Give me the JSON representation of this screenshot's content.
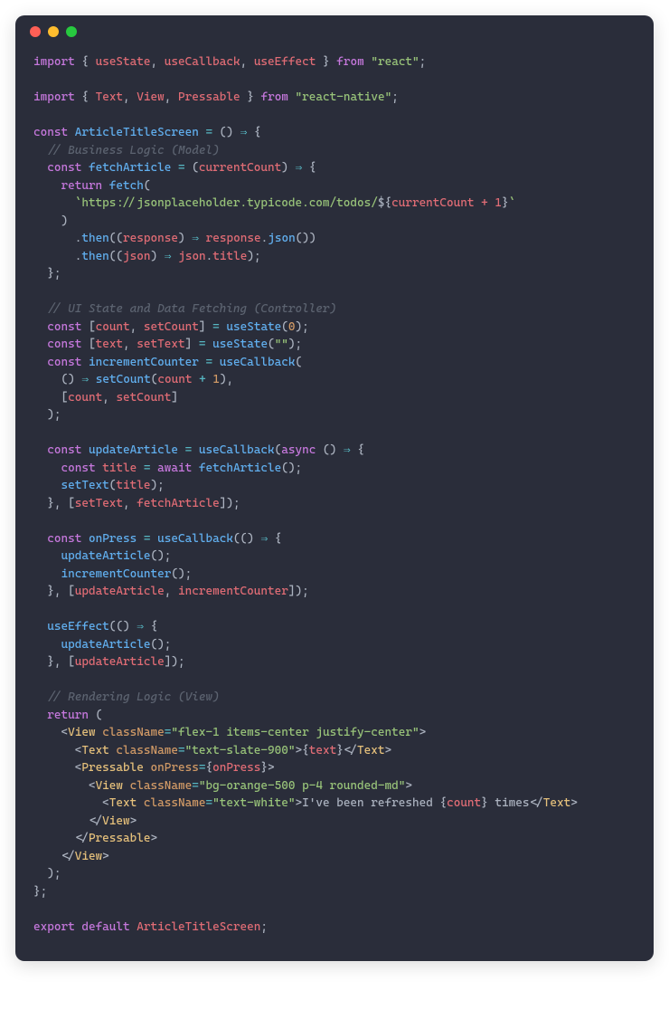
{
  "window": {
    "background": "#2a2d3a",
    "dots": [
      "#ff5f56",
      "#ffbd2e",
      "#27c93f"
    ]
  },
  "code": {
    "lines": [
      [
        [
          "kw",
          "import"
        ],
        [
          "w",
          " "
        ],
        [
          "p",
          "{"
        ],
        [
          "w",
          " "
        ],
        [
          "var",
          "useState"
        ],
        [
          "p",
          ","
        ],
        [
          "w",
          " "
        ],
        [
          "var",
          "useCallback"
        ],
        [
          "p",
          ","
        ],
        [
          "w",
          " "
        ],
        [
          "var",
          "useEffect"
        ],
        [
          "w",
          " "
        ],
        [
          "p",
          "}"
        ],
        [
          "w",
          " "
        ],
        [
          "kw",
          "from"
        ],
        [
          "w",
          " "
        ],
        [
          "str",
          "\"react\""
        ],
        [
          "p",
          ";"
        ]
      ],
      [],
      [
        [
          "kw",
          "import"
        ],
        [
          "w",
          " "
        ],
        [
          "p",
          "{"
        ],
        [
          "w",
          " "
        ],
        [
          "var",
          "Text"
        ],
        [
          "p",
          ","
        ],
        [
          "w",
          " "
        ],
        [
          "var",
          "View"
        ],
        [
          "p",
          ","
        ],
        [
          "w",
          " "
        ],
        [
          "var",
          "Pressable"
        ],
        [
          "w",
          " "
        ],
        [
          "p",
          "}"
        ],
        [
          "w",
          " "
        ],
        [
          "kw",
          "from"
        ],
        [
          "w",
          " "
        ],
        [
          "str",
          "\"react-native\""
        ],
        [
          "p",
          ";"
        ]
      ],
      [],
      [
        [
          "kw",
          "const"
        ],
        [
          "w",
          " "
        ],
        [
          "fn",
          "ArticleTitleScreen"
        ],
        [
          "w",
          " "
        ],
        [
          "op",
          "="
        ],
        [
          "w",
          " "
        ],
        [
          "p",
          "()"
        ],
        [
          "w",
          " "
        ],
        [
          "op",
          "⇒"
        ],
        [
          "w",
          " "
        ],
        [
          "p",
          "{"
        ]
      ],
      [
        [
          "w",
          "  "
        ],
        [
          "cm",
          "// Business Logic (Model)"
        ]
      ],
      [
        [
          "w",
          "  "
        ],
        [
          "kw",
          "const"
        ],
        [
          "w",
          " "
        ],
        [
          "fn",
          "fetchArticle"
        ],
        [
          "w",
          " "
        ],
        [
          "op",
          "="
        ],
        [
          "w",
          " "
        ],
        [
          "p",
          "("
        ],
        [
          "var",
          "currentCount"
        ],
        [
          "p",
          ")"
        ],
        [
          "w",
          " "
        ],
        [
          "op",
          "⇒"
        ],
        [
          "w",
          " "
        ],
        [
          "p",
          "{"
        ]
      ],
      [
        [
          "w",
          "    "
        ],
        [
          "kw",
          "return"
        ],
        [
          "w",
          " "
        ],
        [
          "fn",
          "fetch"
        ],
        [
          "p",
          "("
        ]
      ],
      [
        [
          "w",
          "      "
        ],
        [
          "str",
          "`https://jsonplaceholder.typicode.com/todos/"
        ],
        [
          "p",
          "${"
        ],
        [
          "tmpl",
          "currentCount + 1"
        ],
        [
          "p",
          "}"
        ],
        [
          "str",
          "`"
        ]
      ],
      [
        [
          "w",
          "    "
        ],
        [
          "p",
          ")"
        ]
      ],
      [
        [
          "w",
          "      "
        ],
        [
          "p",
          "."
        ],
        [
          "fn",
          "then"
        ],
        [
          "p",
          "(("
        ],
        [
          "var",
          "response"
        ],
        [
          "p",
          ")"
        ],
        [
          "w",
          " "
        ],
        [
          "op",
          "⇒"
        ],
        [
          "w",
          " "
        ],
        [
          "var",
          "response"
        ],
        [
          "p",
          "."
        ],
        [
          "fn",
          "json"
        ],
        [
          "p",
          "())"
        ]
      ],
      [
        [
          "w",
          "      "
        ],
        [
          "p",
          "."
        ],
        [
          "fn",
          "then"
        ],
        [
          "p",
          "(("
        ],
        [
          "var",
          "json"
        ],
        [
          "p",
          ")"
        ],
        [
          "w",
          " "
        ],
        [
          "op",
          "⇒"
        ],
        [
          "w",
          " "
        ],
        [
          "var",
          "json"
        ],
        [
          "p",
          "."
        ],
        [
          "prop",
          "title"
        ],
        [
          "p",
          ");"
        ]
      ],
      [
        [
          "w",
          "  "
        ],
        [
          "p",
          "};"
        ]
      ],
      [],
      [
        [
          "w",
          "  "
        ],
        [
          "cm",
          "// UI State and Data Fetching (Controller)"
        ]
      ],
      [
        [
          "w",
          "  "
        ],
        [
          "kw",
          "const"
        ],
        [
          "w",
          " "
        ],
        [
          "p",
          "["
        ],
        [
          "var",
          "count"
        ],
        [
          "p",
          ","
        ],
        [
          "w",
          " "
        ],
        [
          "var",
          "setCount"
        ],
        [
          "p",
          "]"
        ],
        [
          "w",
          " "
        ],
        [
          "op",
          "="
        ],
        [
          "w",
          " "
        ],
        [
          "fn",
          "useState"
        ],
        [
          "p",
          "("
        ],
        [
          "num",
          "0"
        ],
        [
          "p",
          ");"
        ]
      ],
      [
        [
          "w",
          "  "
        ],
        [
          "kw",
          "const"
        ],
        [
          "w",
          " "
        ],
        [
          "p",
          "["
        ],
        [
          "var",
          "text"
        ],
        [
          "p",
          ","
        ],
        [
          "w",
          " "
        ],
        [
          "var",
          "setText"
        ],
        [
          "p",
          "]"
        ],
        [
          "w",
          " "
        ],
        [
          "op",
          "="
        ],
        [
          "w",
          " "
        ],
        [
          "fn",
          "useState"
        ],
        [
          "p",
          "("
        ],
        [
          "str",
          "\"\""
        ],
        [
          "p",
          ");"
        ]
      ],
      [
        [
          "w",
          "  "
        ],
        [
          "kw",
          "const"
        ],
        [
          "w",
          " "
        ],
        [
          "fn",
          "incrementCounter"
        ],
        [
          "w",
          " "
        ],
        [
          "op",
          "="
        ],
        [
          "w",
          " "
        ],
        [
          "fn",
          "useCallback"
        ],
        [
          "p",
          "("
        ]
      ],
      [
        [
          "w",
          "    "
        ],
        [
          "p",
          "()"
        ],
        [
          "w",
          " "
        ],
        [
          "op",
          "⇒"
        ],
        [
          "w",
          " "
        ],
        [
          "fn",
          "setCount"
        ],
        [
          "p",
          "("
        ],
        [
          "var",
          "count"
        ],
        [
          "w",
          " "
        ],
        [
          "op",
          "+"
        ],
        [
          "w",
          " "
        ],
        [
          "num",
          "1"
        ],
        [
          "p",
          "),"
        ]
      ],
      [
        [
          "w",
          "    "
        ],
        [
          "p",
          "["
        ],
        [
          "var",
          "count"
        ],
        [
          "p",
          ","
        ],
        [
          "w",
          " "
        ],
        [
          "var",
          "setCount"
        ],
        [
          "p",
          "]"
        ]
      ],
      [
        [
          "w",
          "  "
        ],
        [
          "p",
          ");"
        ]
      ],
      [],
      [
        [
          "w",
          "  "
        ],
        [
          "kw",
          "const"
        ],
        [
          "w",
          " "
        ],
        [
          "fn",
          "updateArticle"
        ],
        [
          "w",
          " "
        ],
        [
          "op",
          "="
        ],
        [
          "w",
          " "
        ],
        [
          "fn",
          "useCallback"
        ],
        [
          "p",
          "("
        ],
        [
          "kw",
          "async"
        ],
        [
          "w",
          " "
        ],
        [
          "p",
          "()"
        ],
        [
          "w",
          " "
        ],
        [
          "op",
          "⇒"
        ],
        [
          "w",
          " "
        ],
        [
          "p",
          "{"
        ]
      ],
      [
        [
          "w",
          "    "
        ],
        [
          "kw",
          "const"
        ],
        [
          "w",
          " "
        ],
        [
          "var",
          "title"
        ],
        [
          "w",
          " "
        ],
        [
          "op",
          "="
        ],
        [
          "w",
          " "
        ],
        [
          "kw",
          "await"
        ],
        [
          "w",
          " "
        ],
        [
          "fn",
          "fetchArticle"
        ],
        [
          "p",
          "();"
        ]
      ],
      [
        [
          "w",
          "    "
        ],
        [
          "fn",
          "setText"
        ],
        [
          "p",
          "("
        ],
        [
          "var",
          "title"
        ],
        [
          "p",
          ");"
        ]
      ],
      [
        [
          "w",
          "  "
        ],
        [
          "p",
          "},"
        ],
        [
          "w",
          " "
        ],
        [
          "p",
          "["
        ],
        [
          "var",
          "setText"
        ],
        [
          "p",
          ","
        ],
        [
          "w",
          " "
        ],
        [
          "var",
          "fetchArticle"
        ],
        [
          "p",
          "]);"
        ]
      ],
      [],
      [
        [
          "w",
          "  "
        ],
        [
          "kw",
          "const"
        ],
        [
          "w",
          " "
        ],
        [
          "fn",
          "onPress"
        ],
        [
          "w",
          " "
        ],
        [
          "op",
          "="
        ],
        [
          "w",
          " "
        ],
        [
          "fn",
          "useCallback"
        ],
        [
          "p",
          "(()"
        ],
        [
          "w",
          " "
        ],
        [
          "op",
          "⇒"
        ],
        [
          "w",
          " "
        ],
        [
          "p",
          "{"
        ]
      ],
      [
        [
          "w",
          "    "
        ],
        [
          "fn",
          "updateArticle"
        ],
        [
          "p",
          "();"
        ]
      ],
      [
        [
          "w",
          "    "
        ],
        [
          "fn",
          "incrementCounter"
        ],
        [
          "p",
          "();"
        ]
      ],
      [
        [
          "w",
          "  "
        ],
        [
          "p",
          "},"
        ],
        [
          "w",
          " "
        ],
        [
          "p",
          "["
        ],
        [
          "var",
          "updateArticle"
        ],
        [
          "p",
          ","
        ],
        [
          "w",
          " "
        ],
        [
          "var",
          "incrementCounter"
        ],
        [
          "p",
          "]);"
        ]
      ],
      [],
      [
        [
          "w",
          "  "
        ],
        [
          "fn",
          "useEffect"
        ],
        [
          "p",
          "(()"
        ],
        [
          "w",
          " "
        ],
        [
          "op",
          "⇒"
        ],
        [
          "w",
          " "
        ],
        [
          "p",
          "{"
        ]
      ],
      [
        [
          "w",
          "    "
        ],
        [
          "fn",
          "updateArticle"
        ],
        [
          "p",
          "();"
        ]
      ],
      [
        [
          "w",
          "  "
        ],
        [
          "p",
          "},"
        ],
        [
          "w",
          " "
        ],
        [
          "p",
          "["
        ],
        [
          "var",
          "updateArticle"
        ],
        [
          "p",
          "]);"
        ]
      ],
      [],
      [
        [
          "w",
          "  "
        ],
        [
          "cm",
          "// Rendering Logic (View)"
        ]
      ],
      [
        [
          "w",
          "  "
        ],
        [
          "kw",
          "return"
        ],
        [
          "w",
          " "
        ],
        [
          "p",
          "("
        ]
      ],
      [
        [
          "w",
          "    "
        ],
        [
          "p",
          "<"
        ],
        [
          "tag",
          "View"
        ],
        [
          "w",
          " "
        ],
        [
          "attr",
          "className"
        ],
        [
          "op",
          "="
        ],
        [
          "str",
          "\"flex-1 items-center justify-center\""
        ],
        [
          "p",
          ">"
        ]
      ],
      [
        [
          "w",
          "      "
        ],
        [
          "p",
          "<"
        ],
        [
          "tag",
          "Text"
        ],
        [
          "w",
          " "
        ],
        [
          "attr",
          "className"
        ],
        [
          "op",
          "="
        ],
        [
          "str",
          "\"text-slate-900\""
        ],
        [
          "p",
          ">{"
        ],
        [
          "var",
          "text"
        ],
        [
          "p",
          "}</"
        ],
        [
          "tag",
          "Text"
        ],
        [
          "p",
          ">"
        ]
      ],
      [
        [
          "w",
          "      "
        ],
        [
          "p",
          "<"
        ],
        [
          "tag",
          "Pressable"
        ],
        [
          "w",
          " "
        ],
        [
          "attr",
          "onPress"
        ],
        [
          "op",
          "="
        ],
        [
          "p",
          "{"
        ],
        [
          "var",
          "onPress"
        ],
        [
          "p",
          "}>"
        ]
      ],
      [
        [
          "w",
          "        "
        ],
        [
          "p",
          "<"
        ],
        [
          "tag",
          "View"
        ],
        [
          "w",
          " "
        ],
        [
          "attr",
          "className"
        ],
        [
          "op",
          "="
        ],
        [
          "str",
          "\"bg-orange-500 p-4 rounded-md\""
        ],
        [
          "p",
          ">"
        ]
      ],
      [
        [
          "w",
          "          "
        ],
        [
          "p",
          "<"
        ],
        [
          "tag",
          "Text"
        ],
        [
          "w",
          " "
        ],
        [
          "attr",
          "className"
        ],
        [
          "op",
          "="
        ],
        [
          "str",
          "\"text-white\""
        ],
        [
          "p",
          ">"
        ],
        [
          "w",
          "I've been refreshed "
        ],
        [
          "p",
          "{"
        ],
        [
          "var",
          "count"
        ],
        [
          "p",
          "}"
        ],
        [
          "w",
          " times"
        ],
        [
          "p",
          "</"
        ],
        [
          "tag",
          "Text"
        ],
        [
          "p",
          ">"
        ]
      ],
      [
        [
          "w",
          "        "
        ],
        [
          "p",
          "</"
        ],
        [
          "tag",
          "View"
        ],
        [
          "p",
          ">"
        ]
      ],
      [
        [
          "w",
          "      "
        ],
        [
          "p",
          "</"
        ],
        [
          "tag",
          "Pressable"
        ],
        [
          "p",
          ">"
        ]
      ],
      [
        [
          "w",
          "    "
        ],
        [
          "p",
          "</"
        ],
        [
          "tag",
          "View"
        ],
        [
          "p",
          ">"
        ]
      ],
      [
        [
          "w",
          "  "
        ],
        [
          "p",
          ");"
        ]
      ],
      [
        [
          "p",
          "};"
        ]
      ],
      [],
      [
        [
          "kw",
          "export"
        ],
        [
          "w",
          " "
        ],
        [
          "kw",
          "default"
        ],
        [
          "w",
          " "
        ],
        [
          "var",
          "ArticleTitleScreen"
        ],
        [
          "p",
          ";"
        ]
      ]
    ]
  }
}
